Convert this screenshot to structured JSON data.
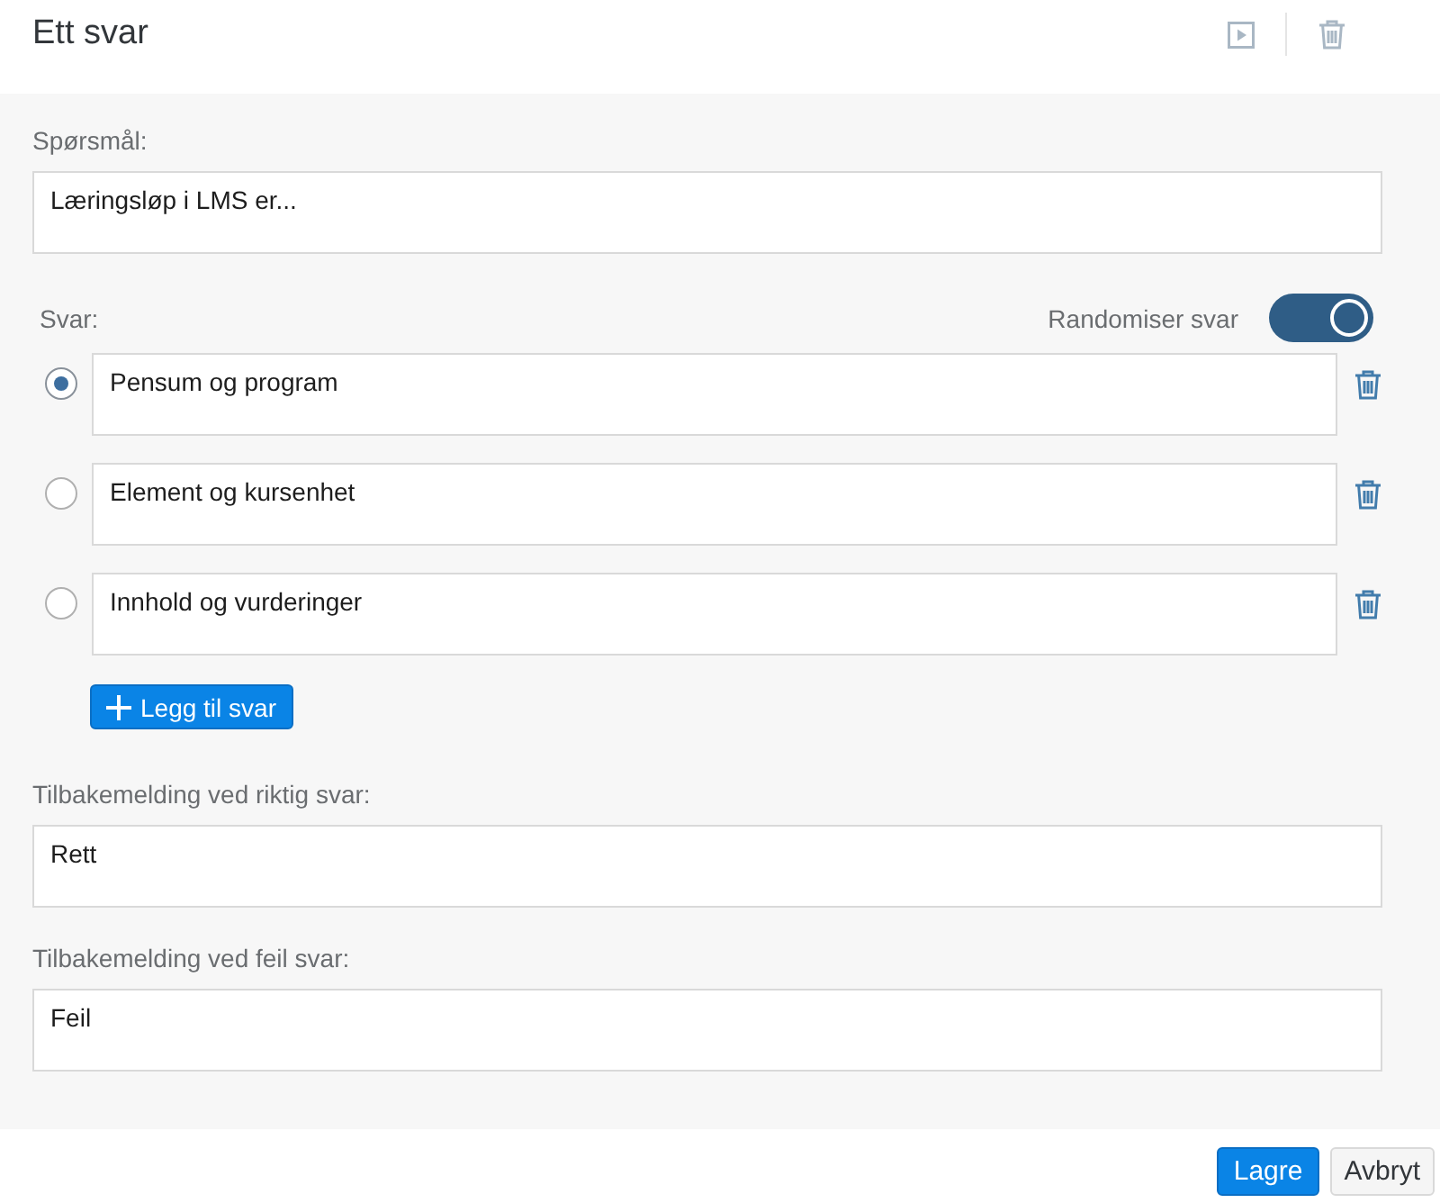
{
  "header": {
    "title": "Ett svar"
  },
  "question": {
    "label": "Spørsmål:",
    "value": "Læringsløp i LMS er..."
  },
  "answers": {
    "label": "Svar:",
    "randomize": {
      "label": "Randomiser svar",
      "on": true
    },
    "items": [
      {
        "value": "Pensum og program",
        "selected": true
      },
      {
        "value": "Element og kursenhet",
        "selected": false
      },
      {
        "value": "Innhold og vurderinger",
        "selected": false
      }
    ],
    "add_button": "Legg til svar"
  },
  "feedback": [
    {
      "label": "Tilbakemelding ved riktig svar:",
      "value": "Rett"
    },
    {
      "label": "Tilbakemelding ved feil svar:",
      "value": "Feil"
    }
  ],
  "footer": {
    "buttons": [
      {
        "label": "Lagre",
        "kind": "primary"
      },
      {
        "label": "Avbryt",
        "kind": "secondary"
      }
    ]
  }
}
